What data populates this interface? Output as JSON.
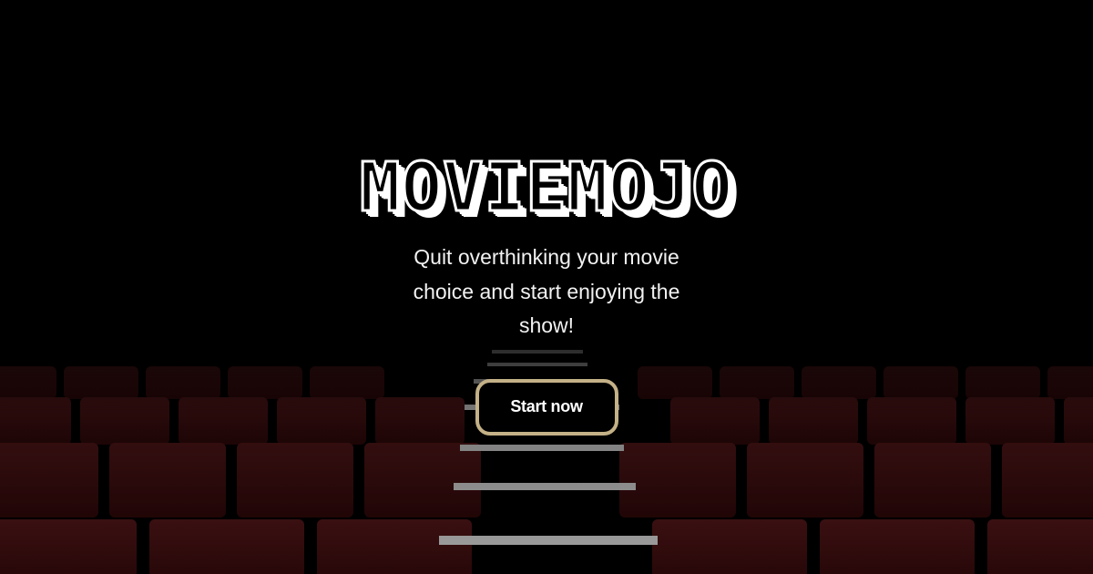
{
  "hero": {
    "logo": "MOVIEMOJO",
    "tagline": "Quit overthinking your movie choice and start enjoying the show!",
    "cta_label": "Start now"
  },
  "colors": {
    "background": "#000000",
    "seat": "#3a0c0e",
    "cta_border": "#c4b187",
    "text": "#ffffff"
  }
}
